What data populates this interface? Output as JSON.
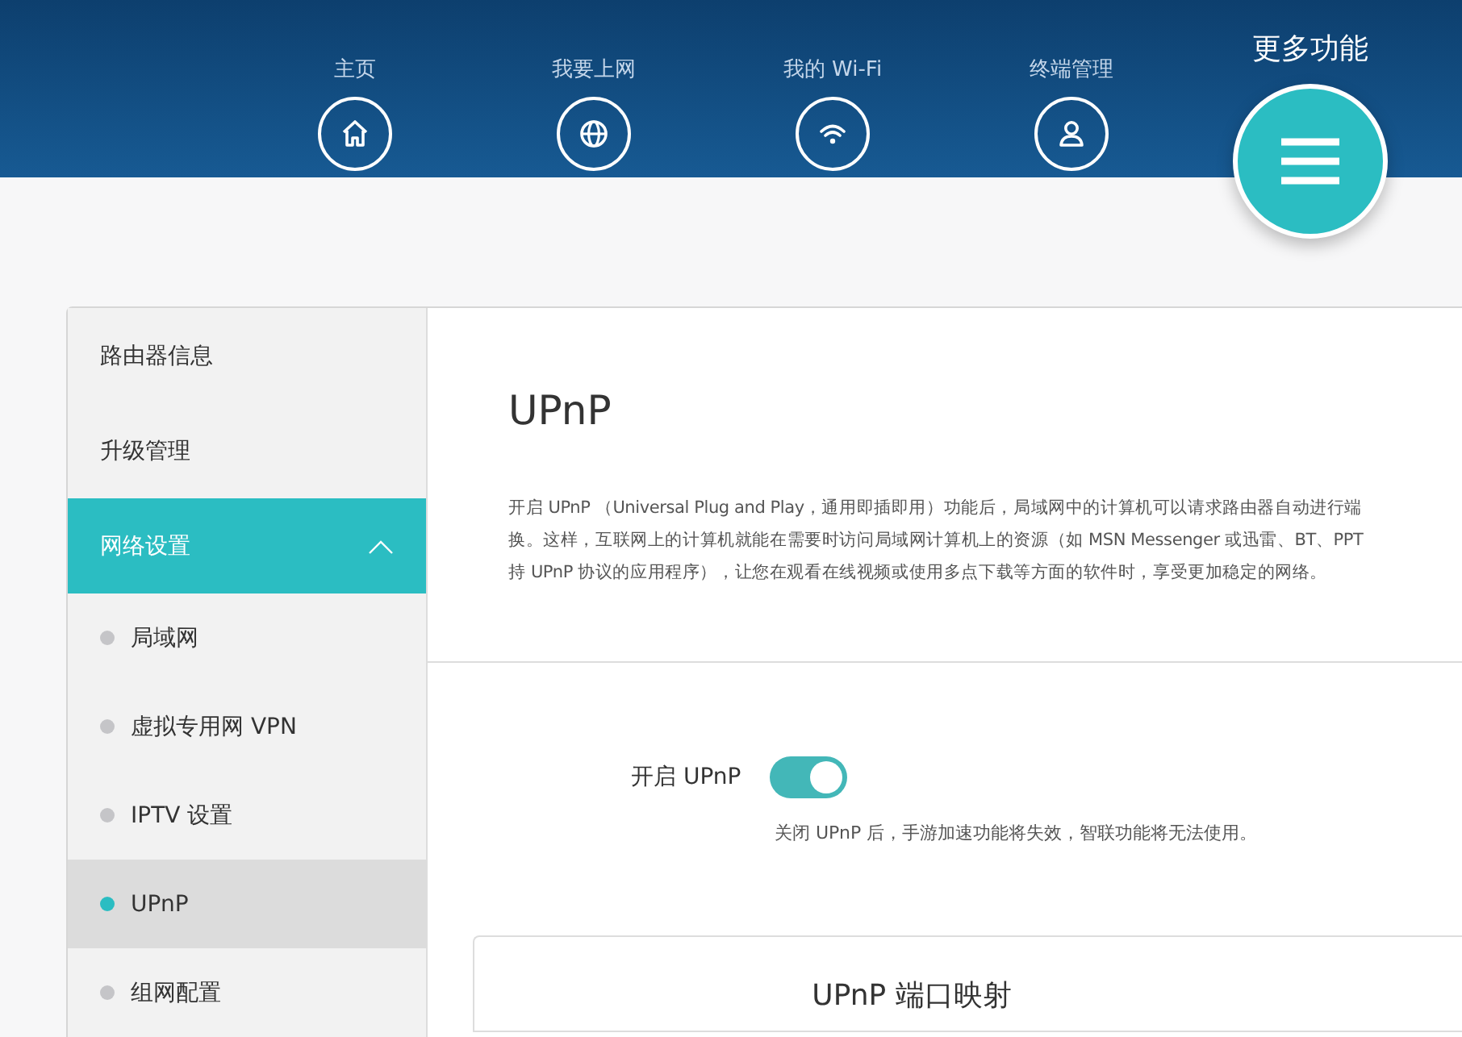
{
  "nav": [
    {
      "label": "主页",
      "kind": "home",
      "selected": false
    },
    {
      "label": "我要上网",
      "kind": "globe",
      "selected": false
    },
    {
      "label": "我的 Wi-Fi",
      "kind": "wifi",
      "selected": false
    },
    {
      "label": "终端管理",
      "kind": "user",
      "selected": false
    },
    {
      "label": "更多功能",
      "kind": "menu",
      "selected": true
    }
  ],
  "sidebar": {
    "items": [
      {
        "label": "路由器信息",
        "selected": false
      },
      {
        "label": "升级管理",
        "selected": false
      },
      {
        "label": "网络设置",
        "selected": true,
        "expanded": true,
        "children": [
          {
            "label": "局域网",
            "selected": false
          },
          {
            "label": "虚拟专用网 VPN",
            "selected": false
          },
          {
            "label": "IPTV 设置",
            "selected": false
          },
          {
            "label": "UPnP",
            "selected": true
          },
          {
            "label": "组网配置",
            "selected": false
          }
        ]
      }
    ]
  },
  "page": {
    "title": "UPnP",
    "description": [
      "开启 UPnP （Universal Plug and Play，通用即插即用）功能后，局域网中的计算机可以请求路由器自动进行端",
      "换。这样，互联网上的计算机就能在需要时访问局域网计算机上的资源（如 MSN Messenger 或迅雷、BT、PPT",
      "持 UPnP 协议的应用程序），让您在观看在线视频或使用多点下载等方面的软件时，享受更加稳定的网络。"
    ],
    "toggle": {
      "label": "开启 UPnP",
      "on": true
    },
    "hint": "关闭 UPnP 后，手游加速功能将失效，智联功能将无法使用。",
    "section_title": "UPnP 端口映射"
  }
}
